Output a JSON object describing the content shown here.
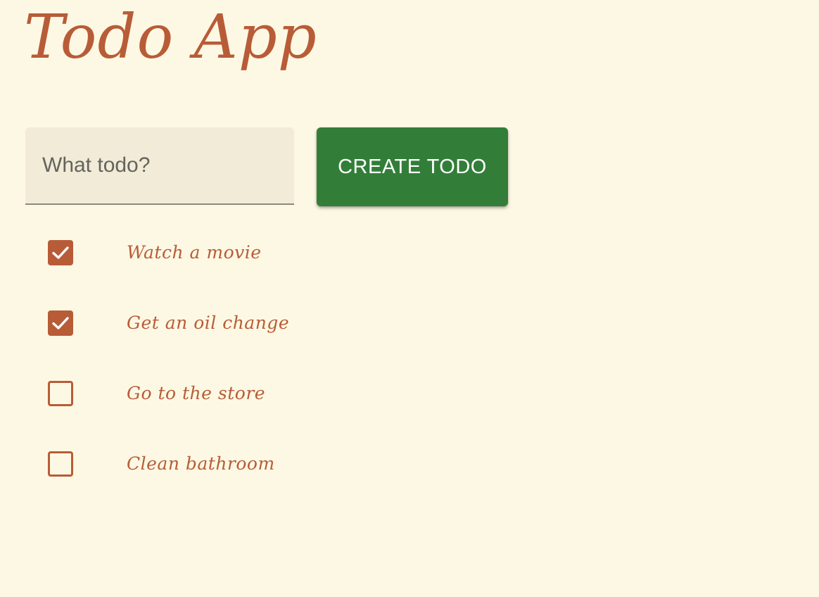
{
  "app": {
    "title": "Todo App"
  },
  "form": {
    "input_placeholder": "What todo?",
    "input_value": "",
    "create_button_label": "CREATE TODO"
  },
  "todos": [
    {
      "label": "Watch a movie",
      "checked": true
    },
    {
      "label": "Get an oil change",
      "checked": true
    },
    {
      "label": "Go to the store",
      "checked": false
    },
    {
      "label": "Clean bathroom",
      "checked": false
    }
  ],
  "colors": {
    "background": "#fdf8e3",
    "accent": "#b85c38",
    "button": "#327e39",
    "input_background": "#f1ebd7"
  },
  "icons": {
    "checked": "checkmark-icon"
  }
}
